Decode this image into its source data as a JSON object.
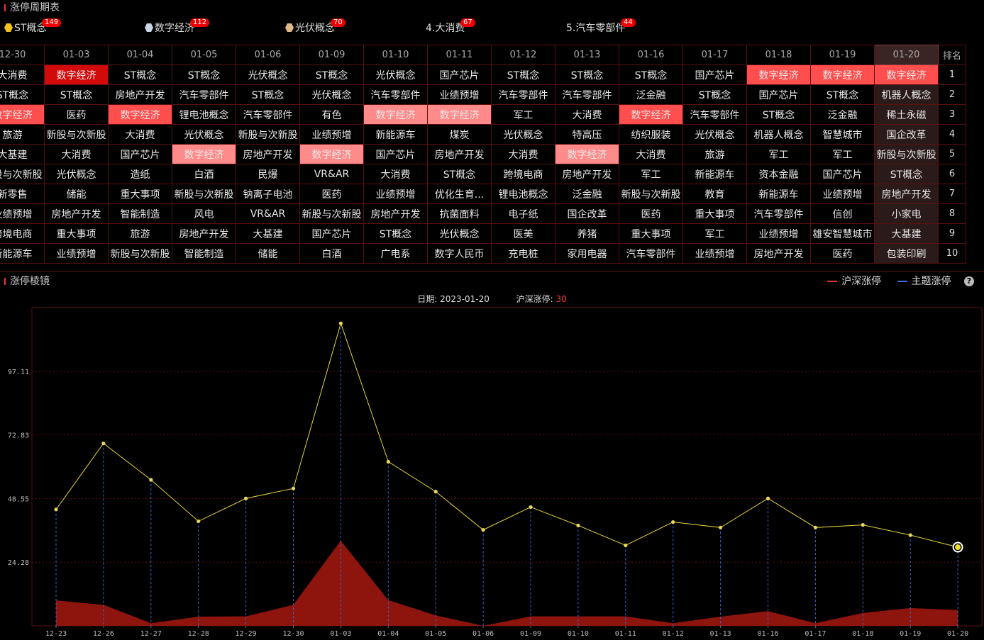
{
  "top_panel": {
    "title": "涨停周期表"
  },
  "themes": [
    {
      "label": "ST概念",
      "count": "149",
      "icon": "gold-hexagon-icon",
      "color": "#f0c419"
    },
    {
      "label": "数字经济",
      "count": "112",
      "icon": "silver-hexagon-icon",
      "color": "#c9d6e3"
    },
    {
      "label": "光伏概念",
      "count": "70",
      "icon": "bronze-hexagon-icon",
      "color": "#e0b98a"
    },
    {
      "label": "4.大消费",
      "count": "67"
    },
    {
      "label": "5.汽车零部件",
      "count": "44"
    }
  ],
  "table": {
    "rank_header": "排名",
    "columns": [
      {
        "date": "12-30",
        "items": [
          "大消费",
          "ST概念",
          "数字经济",
          "旅游",
          "大基建",
          "新股与次新股",
          "新零售",
          "业绩预增",
          "跨境电商",
          "新能源车"
        ],
        "hl": {
          "2": 2
        }
      },
      {
        "date": "01-03",
        "items": [
          "数字经济",
          "ST概念",
          "医药",
          "新股与次新股",
          "大消费",
          "光伏概念",
          "储能",
          "房地产开发",
          "重大事项",
          "业绩预增"
        ],
        "hl": {
          "0": 1
        }
      },
      {
        "date": "01-04",
        "items": [
          "ST概念",
          "房地产开发",
          "数字经济",
          "大消费",
          "国产芯片",
          "造纸",
          "重大事项",
          "智能制造",
          "旅游",
          "新股与次新股"
        ],
        "hl": {
          "2": 2
        }
      },
      {
        "date": "01-05",
        "items": [
          "ST概念",
          "汽车零部件",
          "锂电池概念",
          "光伏概念",
          "数字经济",
          "白酒",
          "新股与次新股",
          "风电",
          "房地产开发",
          "智能制造"
        ],
        "hl": {
          "4": 3
        }
      },
      {
        "date": "01-06",
        "items": [
          "光伏概念",
          "ST概念",
          "汽车零部件",
          "新股与次新股",
          "房地产开发",
          "民爆",
          "钠离子电池",
          "VR&AR",
          "大基建",
          "储能"
        ],
        "hl": {}
      },
      {
        "date": "01-09",
        "items": [
          "ST概念",
          "光伏概念",
          "有色",
          "业绩预增",
          "数字经济",
          "VR&AR",
          "医药",
          "新股与次新股",
          "国产芯片",
          "白酒"
        ],
        "hl": {
          "4": 3
        }
      },
      {
        "date": "01-10",
        "items": [
          "光伏概念",
          "汽车零部件",
          "数字经济",
          "新能源车",
          "国产芯片",
          "大消费",
          "业绩预增",
          "房地产开发",
          "ST概念",
          "广电系"
        ],
        "hl": {
          "2": 3
        }
      },
      {
        "date": "01-11",
        "items": [
          "国产芯片",
          "业绩预增",
          "数字经济",
          "煤炭",
          "房地产开发",
          "ST概念",
          "优化生育...",
          "抗菌面料",
          "光伏概念",
          "数字人民币"
        ],
        "hl": {
          "2": 3
        }
      },
      {
        "date": "01-12",
        "items": [
          "ST概念",
          "汽车零部件",
          "军工",
          "光伏概念",
          "大消费",
          "跨境电商",
          "锂电池概念",
          "电子纸",
          "医美",
          "充电桩"
        ],
        "hl": {}
      },
      {
        "date": "01-13",
        "items": [
          "ST概念",
          "汽车零部件",
          "大消费",
          "特高压",
          "数字经济",
          "房地产开发",
          "泛金融",
          "国企改革",
          "养猪",
          "家用电器"
        ],
        "hl": {
          "4": 3
        }
      },
      {
        "date": "01-16",
        "items": [
          "ST概念",
          "泛金融",
          "数字经济",
          "纺织服装",
          "大消费",
          "军工",
          "新股与次新股",
          "医药",
          "重大事项",
          "汽车零部件"
        ],
        "hl": {
          "2": 2
        }
      },
      {
        "date": "01-17",
        "items": [
          "国产芯片",
          "ST概念",
          "汽车零部件",
          "光伏概念",
          "旅游",
          "新能源车",
          "教育",
          "重大事项",
          "军工",
          "业绩预增"
        ],
        "hl": {}
      },
      {
        "date": "01-18",
        "items": [
          "数字经济",
          "国产芯片",
          "ST概念",
          "机器人概念",
          "军工",
          "资本金融",
          "新能源车",
          "汽车零部件",
          "业绩预增",
          "房地产开发"
        ],
        "hl": {
          "0": 2
        }
      },
      {
        "date": "01-19",
        "items": [
          "数字经济",
          "ST概念",
          "泛金融",
          "智慧城市",
          "军工",
          "国产芯片",
          "业绩预增",
          "信创",
          "雄安智慧城市",
          "医药"
        ],
        "hl": {
          "0": 2
        }
      },
      {
        "date": "01-20",
        "items": [
          "数字经济",
          "机器人概念",
          "稀土永磁",
          "国企改革",
          "新股与次新股",
          "ST概念",
          "房地产开发",
          "小家电",
          "大基建",
          "包装印刷"
        ],
        "hl": {
          "0": 2
        }
      }
    ],
    "ranks": [
      "1",
      "2",
      "3",
      "4",
      "5",
      "6",
      "7",
      "8",
      "9",
      "10"
    ]
  },
  "bottom_panel": {
    "title": "涨停棱镜",
    "legend_market": "沪深涨停",
    "legend_theme": "主题涨停",
    "help": "?",
    "info_date_label": "日期:",
    "info_date": "2023-01-20",
    "info_count_label": "沪深涨停:",
    "info_count": "30"
  },
  "chart_data": {
    "type": "line",
    "title": "",
    "xlabel": "",
    "ylabel": "",
    "categories": [
      "12-23",
      "12-26",
      "12-27",
      "12-28",
      "12-29",
      "12-30",
      "01-03",
      "01-04",
      "01-05",
      "01-06",
      "01-09",
      "01-10",
      "01-11",
      "01-12",
      "01-13",
      "01-16",
      "01-17",
      "01-18",
      "01-19",
      "01-20"
    ],
    "yticks": [
      "24.28",
      "48.55",
      "72.83",
      "97.11"
    ],
    "ylim": [
      0,
      121.4
    ],
    "grid": true,
    "series": [
      {
        "name": "沪深涨停",
        "kind": "area",
        "color": "#8e140e",
        "values": [
          9.7,
          8,
          1,
          3.5,
          3.6,
          8,
          32.5,
          9.8,
          4,
          0,
          3.6,
          3.6,
          3.6,
          1,
          3.5,
          5.6,
          1,
          4.9,
          6.8,
          6
        ]
      },
      {
        "name": "主题涨停",
        "kind": "line",
        "color": "#e5d33a",
        "values": [
          44.4,
          69.6,
          55.7,
          39.9,
          48.6,
          52.4,
          115.4,
          62.6,
          51.2,
          36.6,
          45.3,
          38.3,
          30.7,
          39.6,
          37.5,
          48.6,
          37.5,
          38.5,
          34.6,
          30
        ]
      }
    ]
  },
  "colors": {
    "accent": "#e33333",
    "grid_border": "#5a1010",
    "drop_line": "#3a6ad8"
  }
}
